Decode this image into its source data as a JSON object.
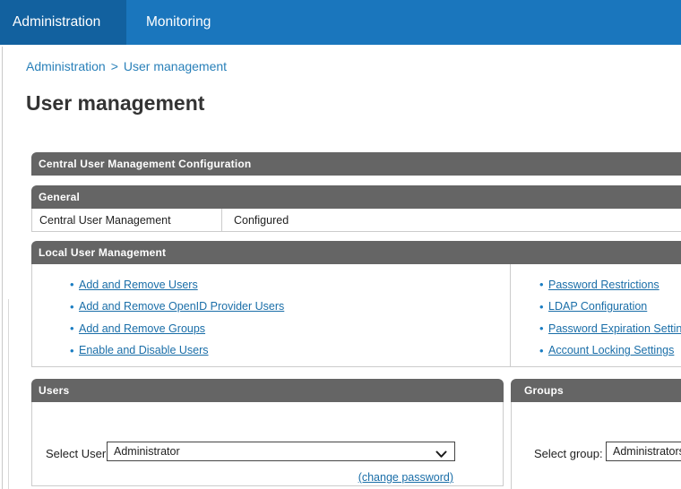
{
  "tabs": {
    "administration": "Administration",
    "monitoring": "Monitoring"
  },
  "breadcrumb": {
    "item1": "Administration",
    "separator": ">",
    "item2": "User management"
  },
  "page_title": "User management",
  "sections": {
    "central_config": {
      "title": "Central User Management Configuration"
    },
    "general": {
      "title": "General",
      "row": {
        "label": "Central User Management",
        "value": "Configured"
      }
    },
    "local": {
      "title": "Local User Management",
      "left_links": [
        "Add and Remove Users",
        "Add and Remove OpenID Provider Users",
        "Add and Remove Groups",
        "Enable and Disable Users"
      ],
      "right_links": [
        "Password Restrictions",
        "LDAP Configuration",
        "Password Expiration Settings",
        "Account Locking Settings"
      ]
    },
    "users": {
      "title": "Users",
      "select_label": "Select User:",
      "selected_user": "Administrator",
      "change_password_label": "(change password)"
    },
    "groups": {
      "title": "Groups",
      "select_label": "Select group:",
      "selected_group": "Administrators"
    }
  },
  "colors": {
    "header_blue": "#1a76bd",
    "active_tab_blue": "#12619f",
    "section_bar_gray": "#656565",
    "link_blue": "#1a6ea8",
    "breadcrumb_blue": "#2980b9",
    "border_gray": "#cccccc"
  }
}
